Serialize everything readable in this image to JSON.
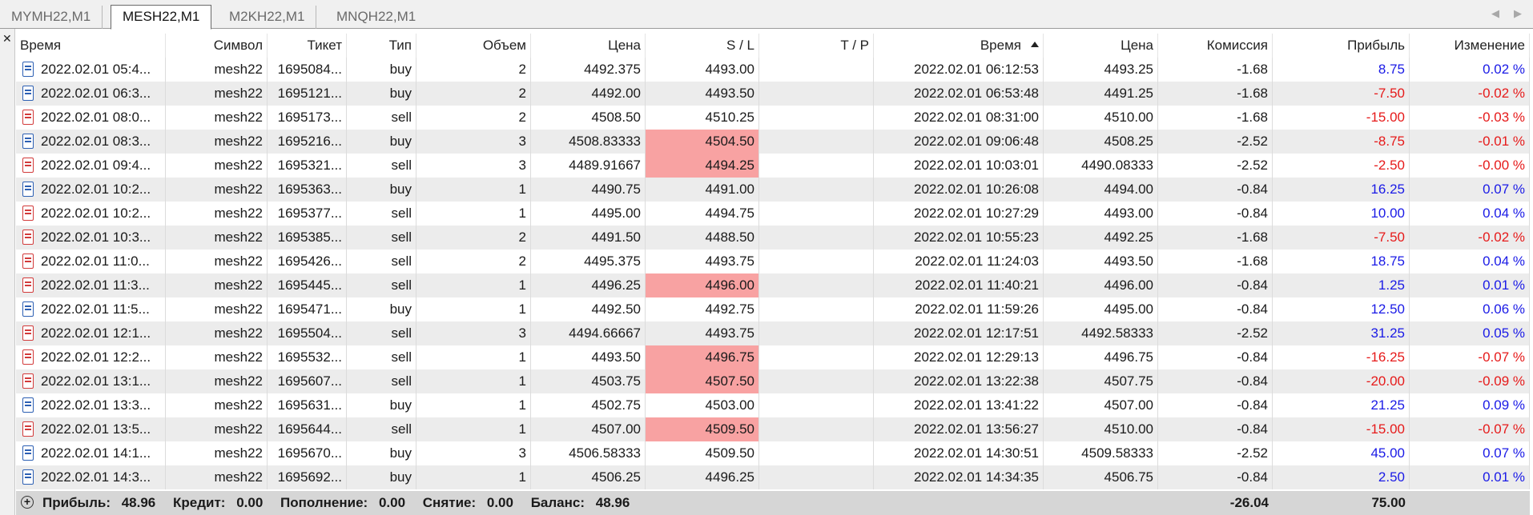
{
  "tabs": [
    {
      "label": "MYMH22,M1",
      "active": false
    },
    {
      "label": "MESH22,M1",
      "active": true
    },
    {
      "label": "M2KH22,M1",
      "active": false
    },
    {
      "label": "MNQH22,M1",
      "active": false
    }
  ],
  "columns": [
    "Время",
    "Символ",
    "Тикет",
    "Тип",
    "Объем",
    "Цена",
    "S / L",
    "T / P",
    "Время",
    "Цена",
    "Комиссия",
    "Прибыль",
    "Изменение"
  ],
  "sort": {
    "column_index": 8,
    "direction": "ascending"
  },
  "colors": {
    "profit_positive": "#1a1ae6",
    "profit_negative": "#e61a1a",
    "sl_hit_highlight": "#f8a2a2",
    "buy_icon": "#2c5fb3",
    "sell_icon": "#d23a3a",
    "alt_row": "#ececec"
  },
  "rows": [
    {
      "open_time": "2022.02.01 05:4...",
      "symbol": "mesh22",
      "ticket": "1695084...",
      "type": "buy",
      "volume": "2",
      "open_price": "4492.375",
      "sl": "4493.00",
      "sl_hit": false,
      "tp": "",
      "close_time": "2022.02.01 06:12:53",
      "close_price": "4493.25",
      "commission": "-1.68",
      "profit": "8.75",
      "change": "0.02 %"
    },
    {
      "open_time": "2022.02.01 06:3...",
      "symbol": "mesh22",
      "ticket": "1695121...",
      "type": "buy",
      "volume": "2",
      "open_price": "4492.00",
      "sl": "4493.50",
      "sl_hit": false,
      "tp": "",
      "close_time": "2022.02.01 06:53:48",
      "close_price": "4491.25",
      "commission": "-1.68",
      "profit": "-7.50",
      "change": "-0.02 %"
    },
    {
      "open_time": "2022.02.01 08:0...",
      "symbol": "mesh22",
      "ticket": "1695173...",
      "type": "sell",
      "volume": "2",
      "open_price": "4508.50",
      "sl": "4510.25",
      "sl_hit": false,
      "tp": "",
      "close_time": "2022.02.01 08:31:00",
      "close_price": "4510.00",
      "commission": "-1.68",
      "profit": "-15.00",
      "change": "-0.03 %"
    },
    {
      "open_time": "2022.02.01 08:3...",
      "symbol": "mesh22",
      "ticket": "1695216...",
      "type": "buy",
      "volume": "3",
      "open_price": "4508.83333",
      "sl": "4504.50",
      "sl_hit": true,
      "tp": "",
      "close_time": "2022.02.01 09:06:48",
      "close_price": "4508.25",
      "commission": "-2.52",
      "profit": "-8.75",
      "change": "-0.01 %"
    },
    {
      "open_time": "2022.02.01 09:4...",
      "symbol": "mesh22",
      "ticket": "1695321...",
      "type": "sell",
      "volume": "3",
      "open_price": "4489.91667",
      "sl": "4494.25",
      "sl_hit": true,
      "tp": "",
      "close_time": "2022.02.01 10:03:01",
      "close_price": "4490.08333",
      "commission": "-2.52",
      "profit": "-2.50",
      "change": "-0.00 %"
    },
    {
      "open_time": "2022.02.01 10:2...",
      "symbol": "mesh22",
      "ticket": "1695363...",
      "type": "buy",
      "volume": "1",
      "open_price": "4490.75",
      "sl": "4491.00",
      "sl_hit": false,
      "tp": "",
      "close_time": "2022.02.01 10:26:08",
      "close_price": "4494.00",
      "commission": "-0.84",
      "profit": "16.25",
      "change": "0.07 %"
    },
    {
      "open_time": "2022.02.01 10:2...",
      "symbol": "mesh22",
      "ticket": "1695377...",
      "type": "sell",
      "volume": "1",
      "open_price": "4495.00",
      "sl": "4494.75",
      "sl_hit": false,
      "tp": "",
      "close_time": "2022.02.01 10:27:29",
      "close_price": "4493.00",
      "commission": "-0.84",
      "profit": "10.00",
      "change": "0.04 %"
    },
    {
      "open_time": "2022.02.01 10:3...",
      "symbol": "mesh22",
      "ticket": "1695385...",
      "type": "sell",
      "volume": "2",
      "open_price": "4491.50",
      "sl": "4488.50",
      "sl_hit": false,
      "tp": "",
      "close_time": "2022.02.01 10:55:23",
      "close_price": "4492.25",
      "commission": "-1.68",
      "profit": "-7.50",
      "change": "-0.02 %"
    },
    {
      "open_time": "2022.02.01 11:0...",
      "symbol": "mesh22",
      "ticket": "1695426...",
      "type": "sell",
      "volume": "2",
      "open_price": "4495.375",
      "sl": "4493.75",
      "sl_hit": false,
      "tp": "",
      "close_time": "2022.02.01 11:24:03",
      "close_price": "4493.50",
      "commission": "-1.68",
      "profit": "18.75",
      "change": "0.04 %"
    },
    {
      "open_time": "2022.02.01 11:3...",
      "symbol": "mesh22",
      "ticket": "1695445...",
      "type": "sell",
      "volume": "1",
      "open_price": "4496.25",
      "sl": "4496.00",
      "sl_hit": true,
      "tp": "",
      "close_time": "2022.02.01 11:40:21",
      "close_price": "4496.00",
      "commission": "-0.84",
      "profit": "1.25",
      "change": "0.01 %"
    },
    {
      "open_time": "2022.02.01 11:5...",
      "symbol": "mesh22",
      "ticket": "1695471...",
      "type": "buy",
      "volume": "1",
      "open_price": "4492.50",
      "sl": "4492.75",
      "sl_hit": false,
      "tp": "",
      "close_time": "2022.02.01 11:59:26",
      "close_price": "4495.00",
      "commission": "-0.84",
      "profit": "12.50",
      "change": "0.06 %"
    },
    {
      "open_time": "2022.02.01 12:1...",
      "symbol": "mesh22",
      "ticket": "1695504...",
      "type": "sell",
      "volume": "3",
      "open_price": "4494.66667",
      "sl": "4493.75",
      "sl_hit": false,
      "tp": "",
      "close_time": "2022.02.01 12:17:51",
      "close_price": "4492.58333",
      "commission": "-2.52",
      "profit": "31.25",
      "change": "0.05 %"
    },
    {
      "open_time": "2022.02.01 12:2...",
      "symbol": "mesh22",
      "ticket": "1695532...",
      "type": "sell",
      "volume": "1",
      "open_price": "4493.50",
      "sl": "4496.75",
      "sl_hit": true,
      "tp": "",
      "close_time": "2022.02.01 12:29:13",
      "close_price": "4496.75",
      "commission": "-0.84",
      "profit": "-16.25",
      "change": "-0.07 %"
    },
    {
      "open_time": "2022.02.01 13:1...",
      "symbol": "mesh22",
      "ticket": "1695607...",
      "type": "sell",
      "volume": "1",
      "open_price": "4503.75",
      "sl": "4507.50",
      "sl_hit": true,
      "tp": "",
      "close_time": "2022.02.01 13:22:38",
      "close_price": "4507.75",
      "commission": "-0.84",
      "profit": "-20.00",
      "change": "-0.09 %"
    },
    {
      "open_time": "2022.02.01 13:3...",
      "symbol": "mesh22",
      "ticket": "1695631...",
      "type": "buy",
      "volume": "1",
      "open_price": "4502.75",
      "sl": "4503.00",
      "sl_hit": false,
      "tp": "",
      "close_time": "2022.02.01 13:41:22",
      "close_price": "4507.00",
      "commission": "-0.84",
      "profit": "21.25",
      "change": "0.09 %"
    },
    {
      "open_time": "2022.02.01 13:5...",
      "symbol": "mesh22",
      "ticket": "1695644...",
      "type": "sell",
      "volume": "1",
      "open_price": "4507.00",
      "sl": "4509.50",
      "sl_hit": true,
      "tp": "",
      "close_time": "2022.02.01 13:56:27",
      "close_price": "4510.00",
      "commission": "-0.84",
      "profit": "-15.00",
      "change": "-0.07 %"
    },
    {
      "open_time": "2022.02.01 14:1...",
      "symbol": "mesh22",
      "ticket": "1695670...",
      "type": "buy",
      "volume": "3",
      "open_price": "4506.58333",
      "sl": "4509.50",
      "sl_hit": false,
      "tp": "",
      "close_time": "2022.02.01 14:30:51",
      "close_price": "4509.58333",
      "commission": "-2.52",
      "profit": "45.00",
      "change": "0.07 %"
    },
    {
      "open_time": "2022.02.01 14:3...",
      "symbol": "mesh22",
      "ticket": "1695692...",
      "type": "buy",
      "volume": "1",
      "open_price": "4506.25",
      "sl": "4496.25",
      "sl_hit": false,
      "tp": "",
      "close_time": "2022.02.01 14:34:35",
      "close_price": "4506.75",
      "commission": "-0.84",
      "profit": "2.50",
      "change": "0.01 %"
    }
  ],
  "footer": {
    "summary": [
      {
        "label": "Прибыль:",
        "value": "48.96"
      },
      {
        "label": "Кредит:",
        "value": "0.00"
      },
      {
        "label": "Пополнение:",
        "value": "0.00"
      },
      {
        "label": "Снятие:",
        "value": "0.00"
      },
      {
        "label": "Баланс:",
        "value": "48.96"
      }
    ],
    "total_commission": "-26.04",
    "total_profit": "75.00"
  }
}
